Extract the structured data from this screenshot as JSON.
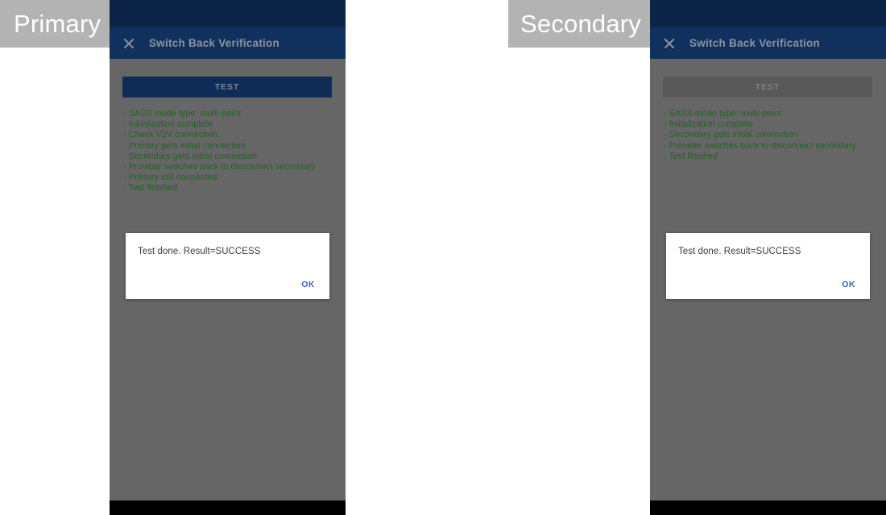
{
  "captions": {
    "primary": "Primary",
    "secondary": "Secondary"
  },
  "colors": {
    "status_bar": "#0d2449",
    "app_bar": "#10305e",
    "scrim": "#666666",
    "log_text": "#216322",
    "button_enabled": "#0f2c57",
    "button_disabled": "#595959",
    "dialog_action": "#3567c4",
    "caption_chip": "#b3b3b3",
    "nav_bar": "#000000"
  },
  "panels": [
    {
      "id": "primary",
      "app_bar": {
        "close_icon": "close-icon",
        "title": "Switch Back Verification"
      },
      "test_button": {
        "label": "TEST",
        "state": "enabled"
      },
      "log_lines": [
        "- SASS mode type: multi-point",
        "- Initialization complete",
        "- Check V2V connection.",
        "- Primary gets initial connection",
        "- Secondary gets initial connection",
        "- Provider switches back to disconnect secondary",
        "- Primary still connected.",
        "- Test finished"
      ],
      "dialog": {
        "message": "Test done. Result=SUCCESS",
        "ok_label": "OK"
      }
    },
    {
      "id": "secondary",
      "app_bar": {
        "close_icon": "close-icon",
        "title": "Switch Back Verification"
      },
      "test_button": {
        "label": "TEST",
        "state": "disabled"
      },
      "log_lines": [
        "- SASS mode type: multi-point",
        "- Initialization complete",
        "- Secondary gets initial connection",
        "- Provider switches back to disconnect secondary",
        "- Test finished"
      ],
      "dialog": {
        "message": "Test done. Result=SUCCESS",
        "ok_label": "OK"
      }
    }
  ]
}
